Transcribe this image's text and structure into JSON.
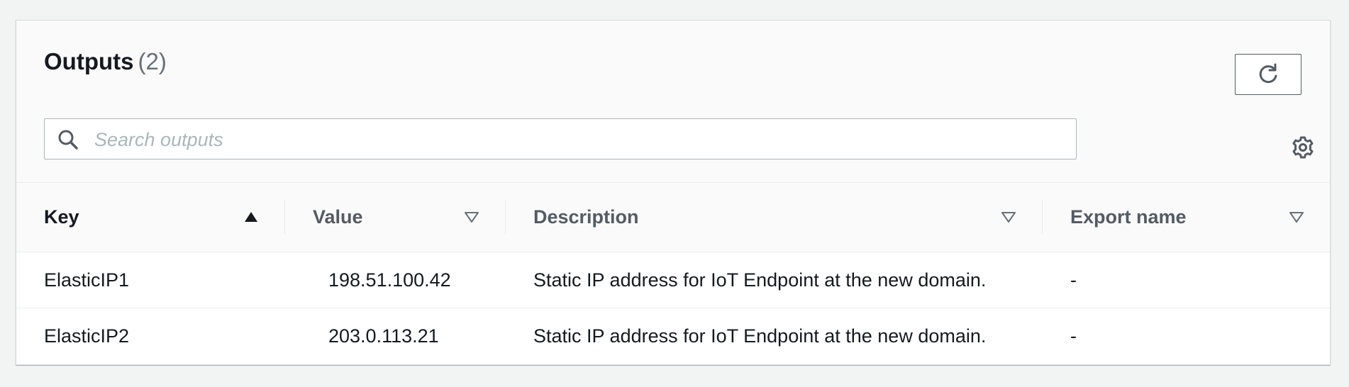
{
  "panel": {
    "title": "Outputs",
    "count": "(2)"
  },
  "search": {
    "placeholder": "Search outputs",
    "value": ""
  },
  "icons": {
    "refresh": "refresh-icon",
    "search": "search-icon",
    "settings": "gear-icon",
    "sort_asc": "caret-up-filled-icon",
    "sort_none": "caret-down-outline-icon"
  },
  "table": {
    "columns": [
      {
        "label": "Key",
        "sort": "ascending"
      },
      {
        "label": "Value",
        "sort": "none"
      },
      {
        "label": "Description",
        "sort": "none"
      },
      {
        "label": "Export name",
        "sort": "none"
      }
    ],
    "rows": [
      {
        "key": "ElasticIP1",
        "value": "198.51.100.42",
        "description": "Static IP address for IoT Endpoint at the new domain.",
        "export_name": "-"
      },
      {
        "key": "ElasticIP2",
        "value": "203.0.113.21",
        "description": "Static IP address for IoT Endpoint at the new domain.",
        "export_name": "-"
      }
    ]
  },
  "colors": {
    "text_primary": "#16191f",
    "text_secondary": "#545b64",
    "border": "#eaeded",
    "header_bg": "#fafafa"
  }
}
